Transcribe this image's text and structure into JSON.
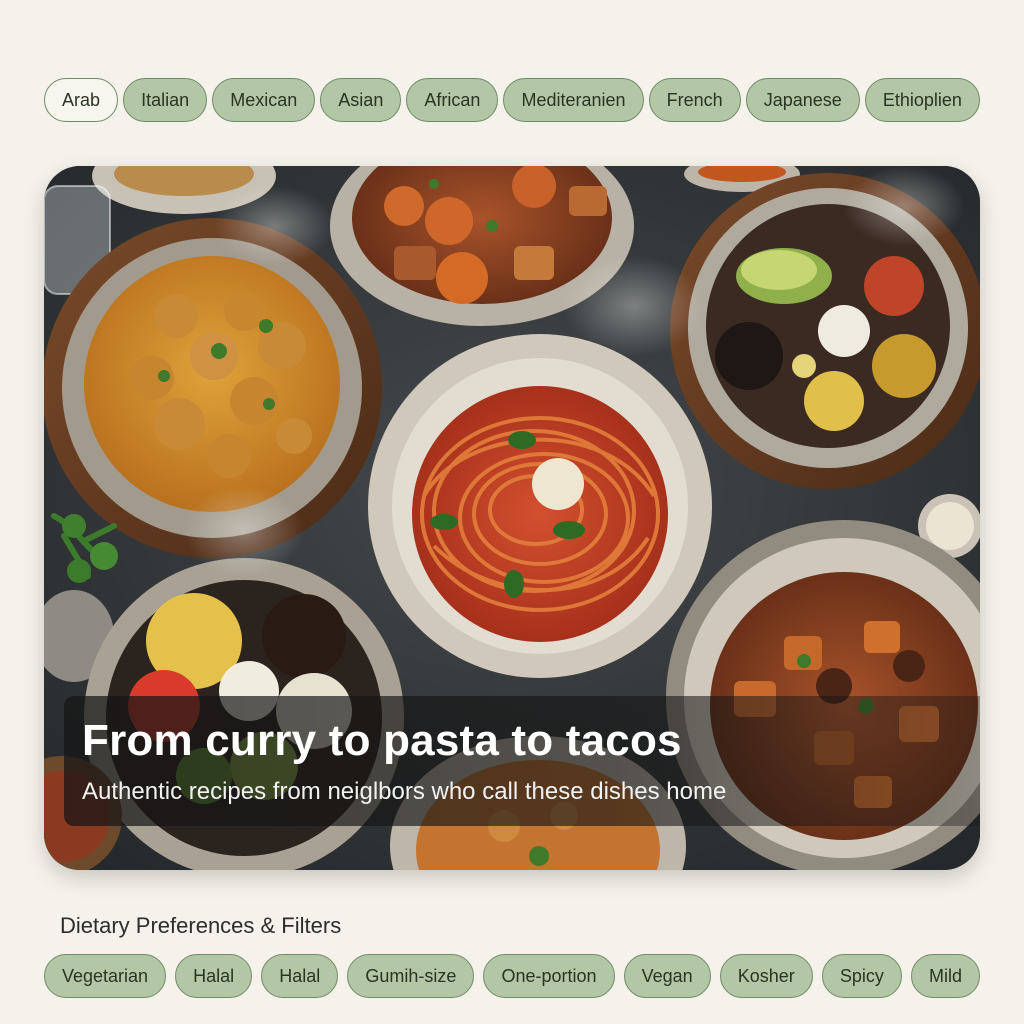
{
  "cuisine_filters": {
    "chips": [
      {
        "label": "Arab",
        "selected": true
      },
      {
        "label": "Italian",
        "selected": false
      },
      {
        "label": "Mexican",
        "selected": false
      },
      {
        "label": "Asian",
        "selected": false
      },
      {
        "label": "African",
        "selected": false
      },
      {
        "label": "Mediteranien",
        "selected": false
      },
      {
        "label": "French",
        "selected": false
      },
      {
        "label": "Japanese",
        "selected": false
      },
      {
        "label": "Ethioplien",
        "selected": false
      }
    ]
  },
  "hero": {
    "title": "From curry to pasta to tacos",
    "subtitle": "Authentic recipes from neiglbors who call these dishes home"
  },
  "dietary": {
    "heading": "Dietary Preferences & Filters",
    "chips": [
      {
        "label": "Vegetarian"
      },
      {
        "label": "Halal"
      },
      {
        "label": "Halal"
      },
      {
        "label": "Gumih-size"
      },
      {
        "label": "One-portion"
      },
      {
        "label": "Vegan"
      },
      {
        "label": "Kosher"
      },
      {
        "label": "Spicy"
      },
      {
        "label": "Mild"
      }
    ]
  },
  "colors": {
    "background": "#f4f2ea",
    "chip_fill": "#b3c7a6",
    "chip_border": "#6f8b66",
    "chip_selected_fill": "#f7f6ee"
  }
}
